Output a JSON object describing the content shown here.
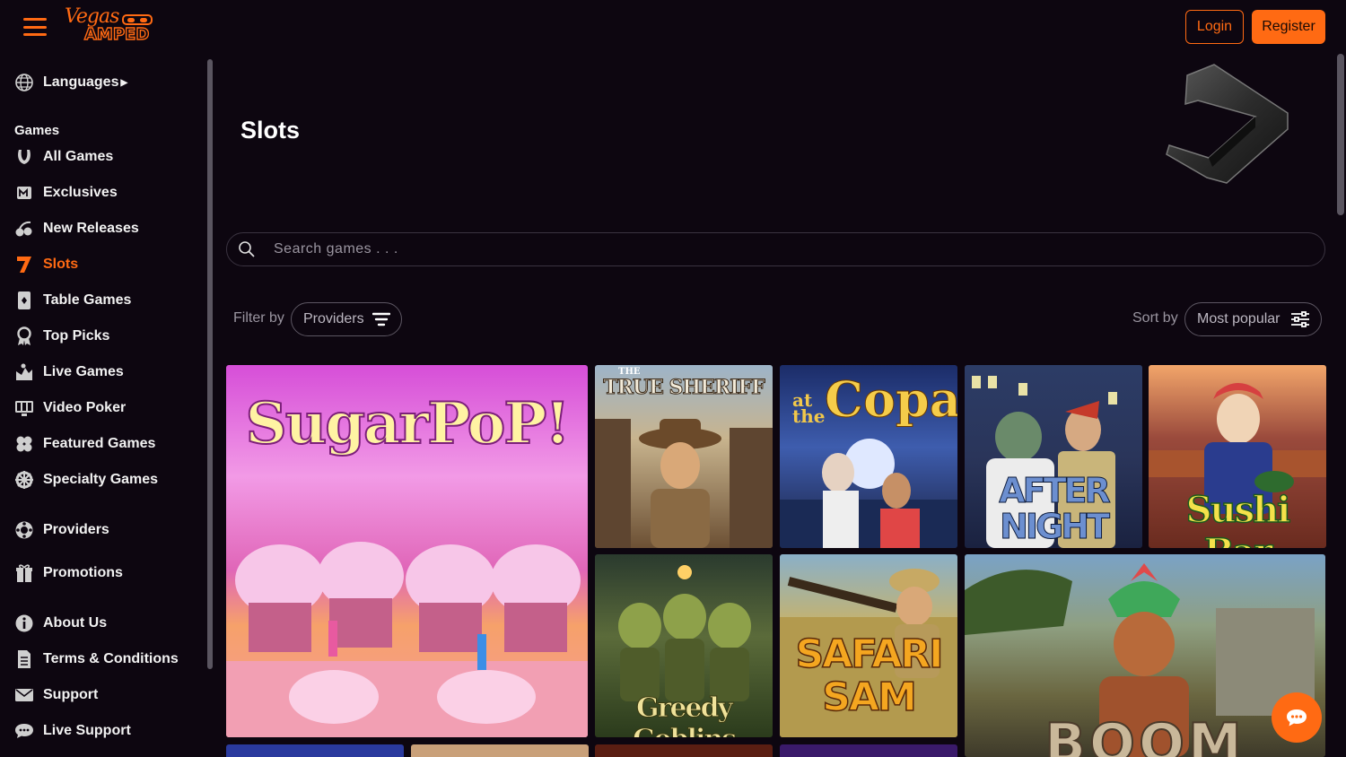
{
  "header": {
    "logo_top": "Vegas",
    "logo_bottom": "AMPED",
    "login_label": "Login",
    "register_label": "Register"
  },
  "sidebar": {
    "languages_label": "Languages",
    "games_heading": "Games",
    "items": [
      {
        "label": "All Games",
        "icon": "horseshoe-icon"
      },
      {
        "label": "Exclusives",
        "icon": "exclusive-badge-icon"
      },
      {
        "label": "New Releases",
        "icon": "cherries-icon"
      },
      {
        "label": "Slots",
        "icon": "seven-icon",
        "active": true
      },
      {
        "label": "Table Games",
        "icon": "card-icon"
      },
      {
        "label": "Top Picks",
        "icon": "award-icon"
      },
      {
        "label": "Live Games",
        "icon": "live-dealer-icon"
      },
      {
        "label": "Video Poker",
        "icon": "video-poker-icon"
      },
      {
        "label": "Featured Games",
        "icon": "clover-icon"
      },
      {
        "label": "Specialty Games",
        "icon": "wheel-icon"
      }
    ],
    "providers_label": "Providers",
    "promotions_label": "Promotions",
    "about_label": "About Us",
    "terms_label": "Terms & Conditions",
    "support_label": "Support",
    "live_support_label": "Live Support"
  },
  "main": {
    "title": "Slots",
    "search_placeholder": "Search games . . .",
    "filter_label": "Filter by",
    "filter_value": "Providers",
    "sort_label": "Sort by",
    "sort_value": "Most popular"
  },
  "games": {
    "sugar_pop": "SugarPoP!",
    "true_sheriff": "TRUE SHERIFF",
    "true_sheriff_small": "THE",
    "at_the_copa": "Copa",
    "at_the_copa_small": "at the",
    "after_night_falls": "AFTER NIGHT FALLS",
    "sushi_bar": "Sushi Bar",
    "greedy_goblins": "Greedy Goblins",
    "safari_sam": "SAFARI SAM",
    "boomk": "BOOM"
  },
  "colors": {
    "accent": "#ff6a13",
    "background": "#0d0610"
  }
}
